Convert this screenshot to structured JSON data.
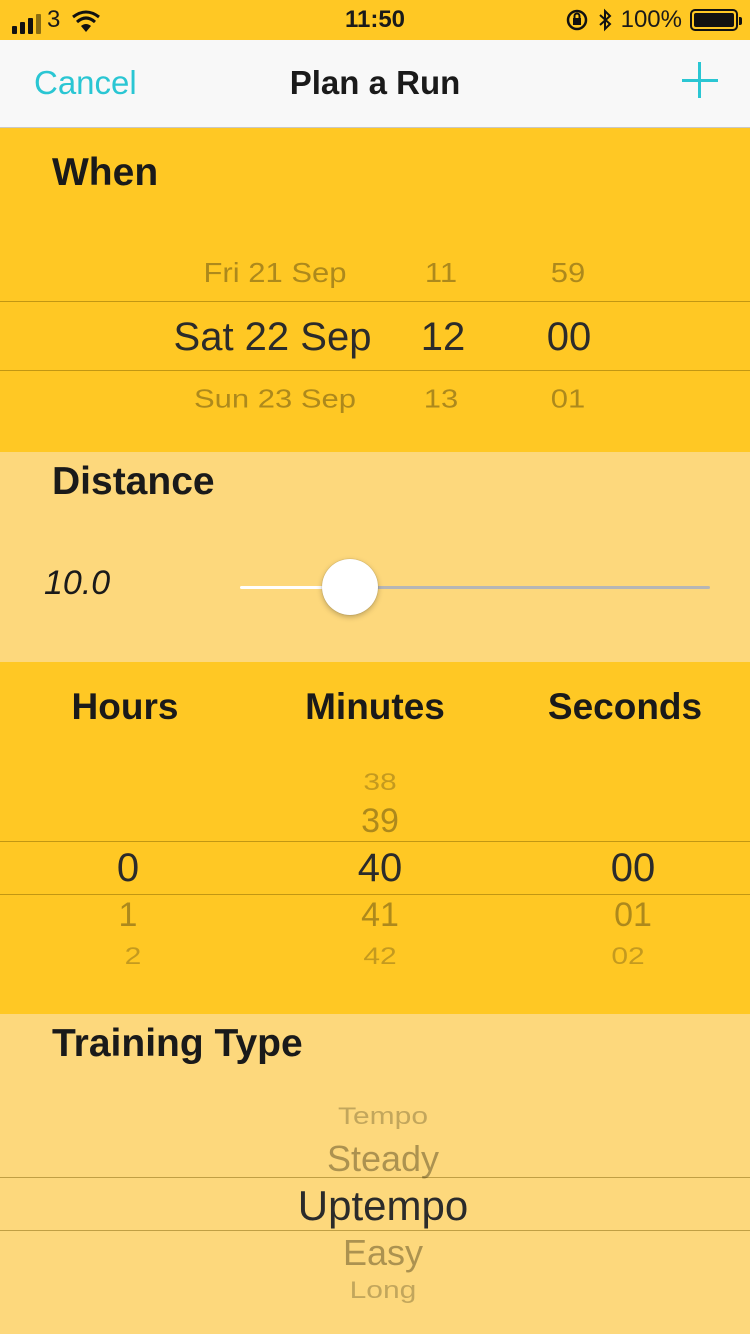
{
  "status_bar": {
    "carrier": "3",
    "time": "11:50",
    "battery_text": "100%",
    "battery_level": 1.0
  },
  "nav": {
    "cancel_label": "Cancel",
    "title": "Plan a Run",
    "add_icon": "plus-icon"
  },
  "when": {
    "heading": "When",
    "dates": [
      "Fri 21 Sep",
      "Sat 22 Sep",
      "Sun 23 Sep"
    ],
    "hours": [
      "11",
      "12",
      "13"
    ],
    "minutes": [
      "59",
      "00",
      "01"
    ]
  },
  "distance": {
    "heading": "Distance",
    "value_text": "10.0",
    "slider_fraction": 0.23
  },
  "duration": {
    "hours_label": "Hours",
    "minutes_label": "Minutes",
    "seconds_label": "Seconds",
    "hours": [
      "0",
      "1",
      "2"
    ],
    "minutes": [
      "38",
      "39",
      "40",
      "41",
      "42"
    ],
    "seconds": [
      "00",
      "01",
      "02"
    ]
  },
  "training": {
    "heading": "Training Type",
    "options": [
      "Tempo",
      "Steady",
      "Uptempo",
      "Easy",
      "Long"
    ]
  },
  "colors": {
    "accent": "#2ac6d3",
    "primary_bg": "#ffc824",
    "secondary_bg": "#fdd87c"
  }
}
